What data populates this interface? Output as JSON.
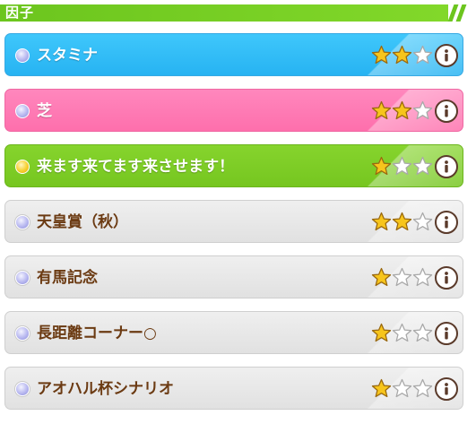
{
  "header": {
    "title": "因子"
  },
  "factors": [
    {
      "name": "スタミナ",
      "stars": 2,
      "max_stars": 3,
      "style": "blue",
      "dot": "lilac"
    },
    {
      "name": "芝",
      "stars": 2,
      "max_stars": 3,
      "style": "pink",
      "dot": "lilac"
    },
    {
      "name": "来ます来てます来させます！",
      "stars": 1,
      "max_stars": 3,
      "style": "green",
      "dot": "gold"
    },
    {
      "name": "天皇賞（秋）",
      "stars": 2,
      "max_stars": 3,
      "style": "gray",
      "dot": "lilac"
    },
    {
      "name": "有馬記念",
      "stars": 1,
      "max_stars": 3,
      "style": "gray",
      "dot": "lilac"
    },
    {
      "name": "長距離コーナー○",
      "stars": 1,
      "max_stars": 3,
      "style": "gray",
      "dot": "lilac"
    },
    {
      "name": "アオハル杯シナリオ",
      "stars": 1,
      "max_stars": 3,
      "style": "gray",
      "dot": "lilac"
    }
  ],
  "icons": {
    "star_filled": "star-filled-icon",
    "star_empty": "star-empty-icon",
    "info": "info-icon"
  },
  "colors": {
    "header_green": "#6cc51e",
    "stamina_blue": "#27b3f2",
    "turf_pink": "#fe6fac",
    "unique_green": "#76c620",
    "gray_card": "#e6e6e6",
    "name_brown": "#6b3a12",
    "star_gold": "#f7c51c"
  }
}
